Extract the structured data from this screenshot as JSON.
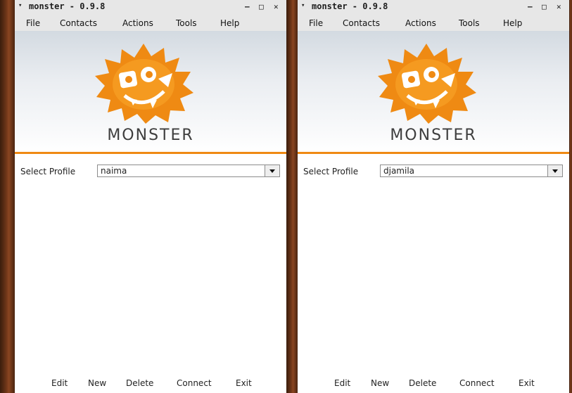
{
  "windows": [
    {
      "title": "monster - 0.9.8",
      "menu": [
        "File",
        "Contacts",
        "Actions",
        "Tools",
        "Help"
      ],
      "logo_text": "MONSTER",
      "profile_label": "Select Profile",
      "profile_value": "naima",
      "buttons": [
        "Edit",
        "New",
        "Delete",
        "Connect",
        "Exit"
      ]
    },
    {
      "title": "monster - 0.9.8",
      "menu": [
        "File",
        "Contacts",
        "Actions",
        "Tools",
        "Help"
      ],
      "logo_text": "MONSTER",
      "profile_label": "Select Profile",
      "profile_value": "djamila",
      "buttons": [
        "Edit",
        "New",
        "Delete",
        "Connect",
        "Exit"
      ]
    }
  ],
  "controls": {
    "window_menu": "▾",
    "minimize": "–",
    "maximize": "□",
    "close": "✕"
  },
  "colors": {
    "brand_orange": "#ef8a13",
    "desktop_brown": "#6b3418"
  },
  "icons": [
    "window-menu-icon",
    "minimize-icon",
    "maximize-icon",
    "close-icon",
    "monster-logo-icon",
    "dropdown-arrow-icon"
  ]
}
